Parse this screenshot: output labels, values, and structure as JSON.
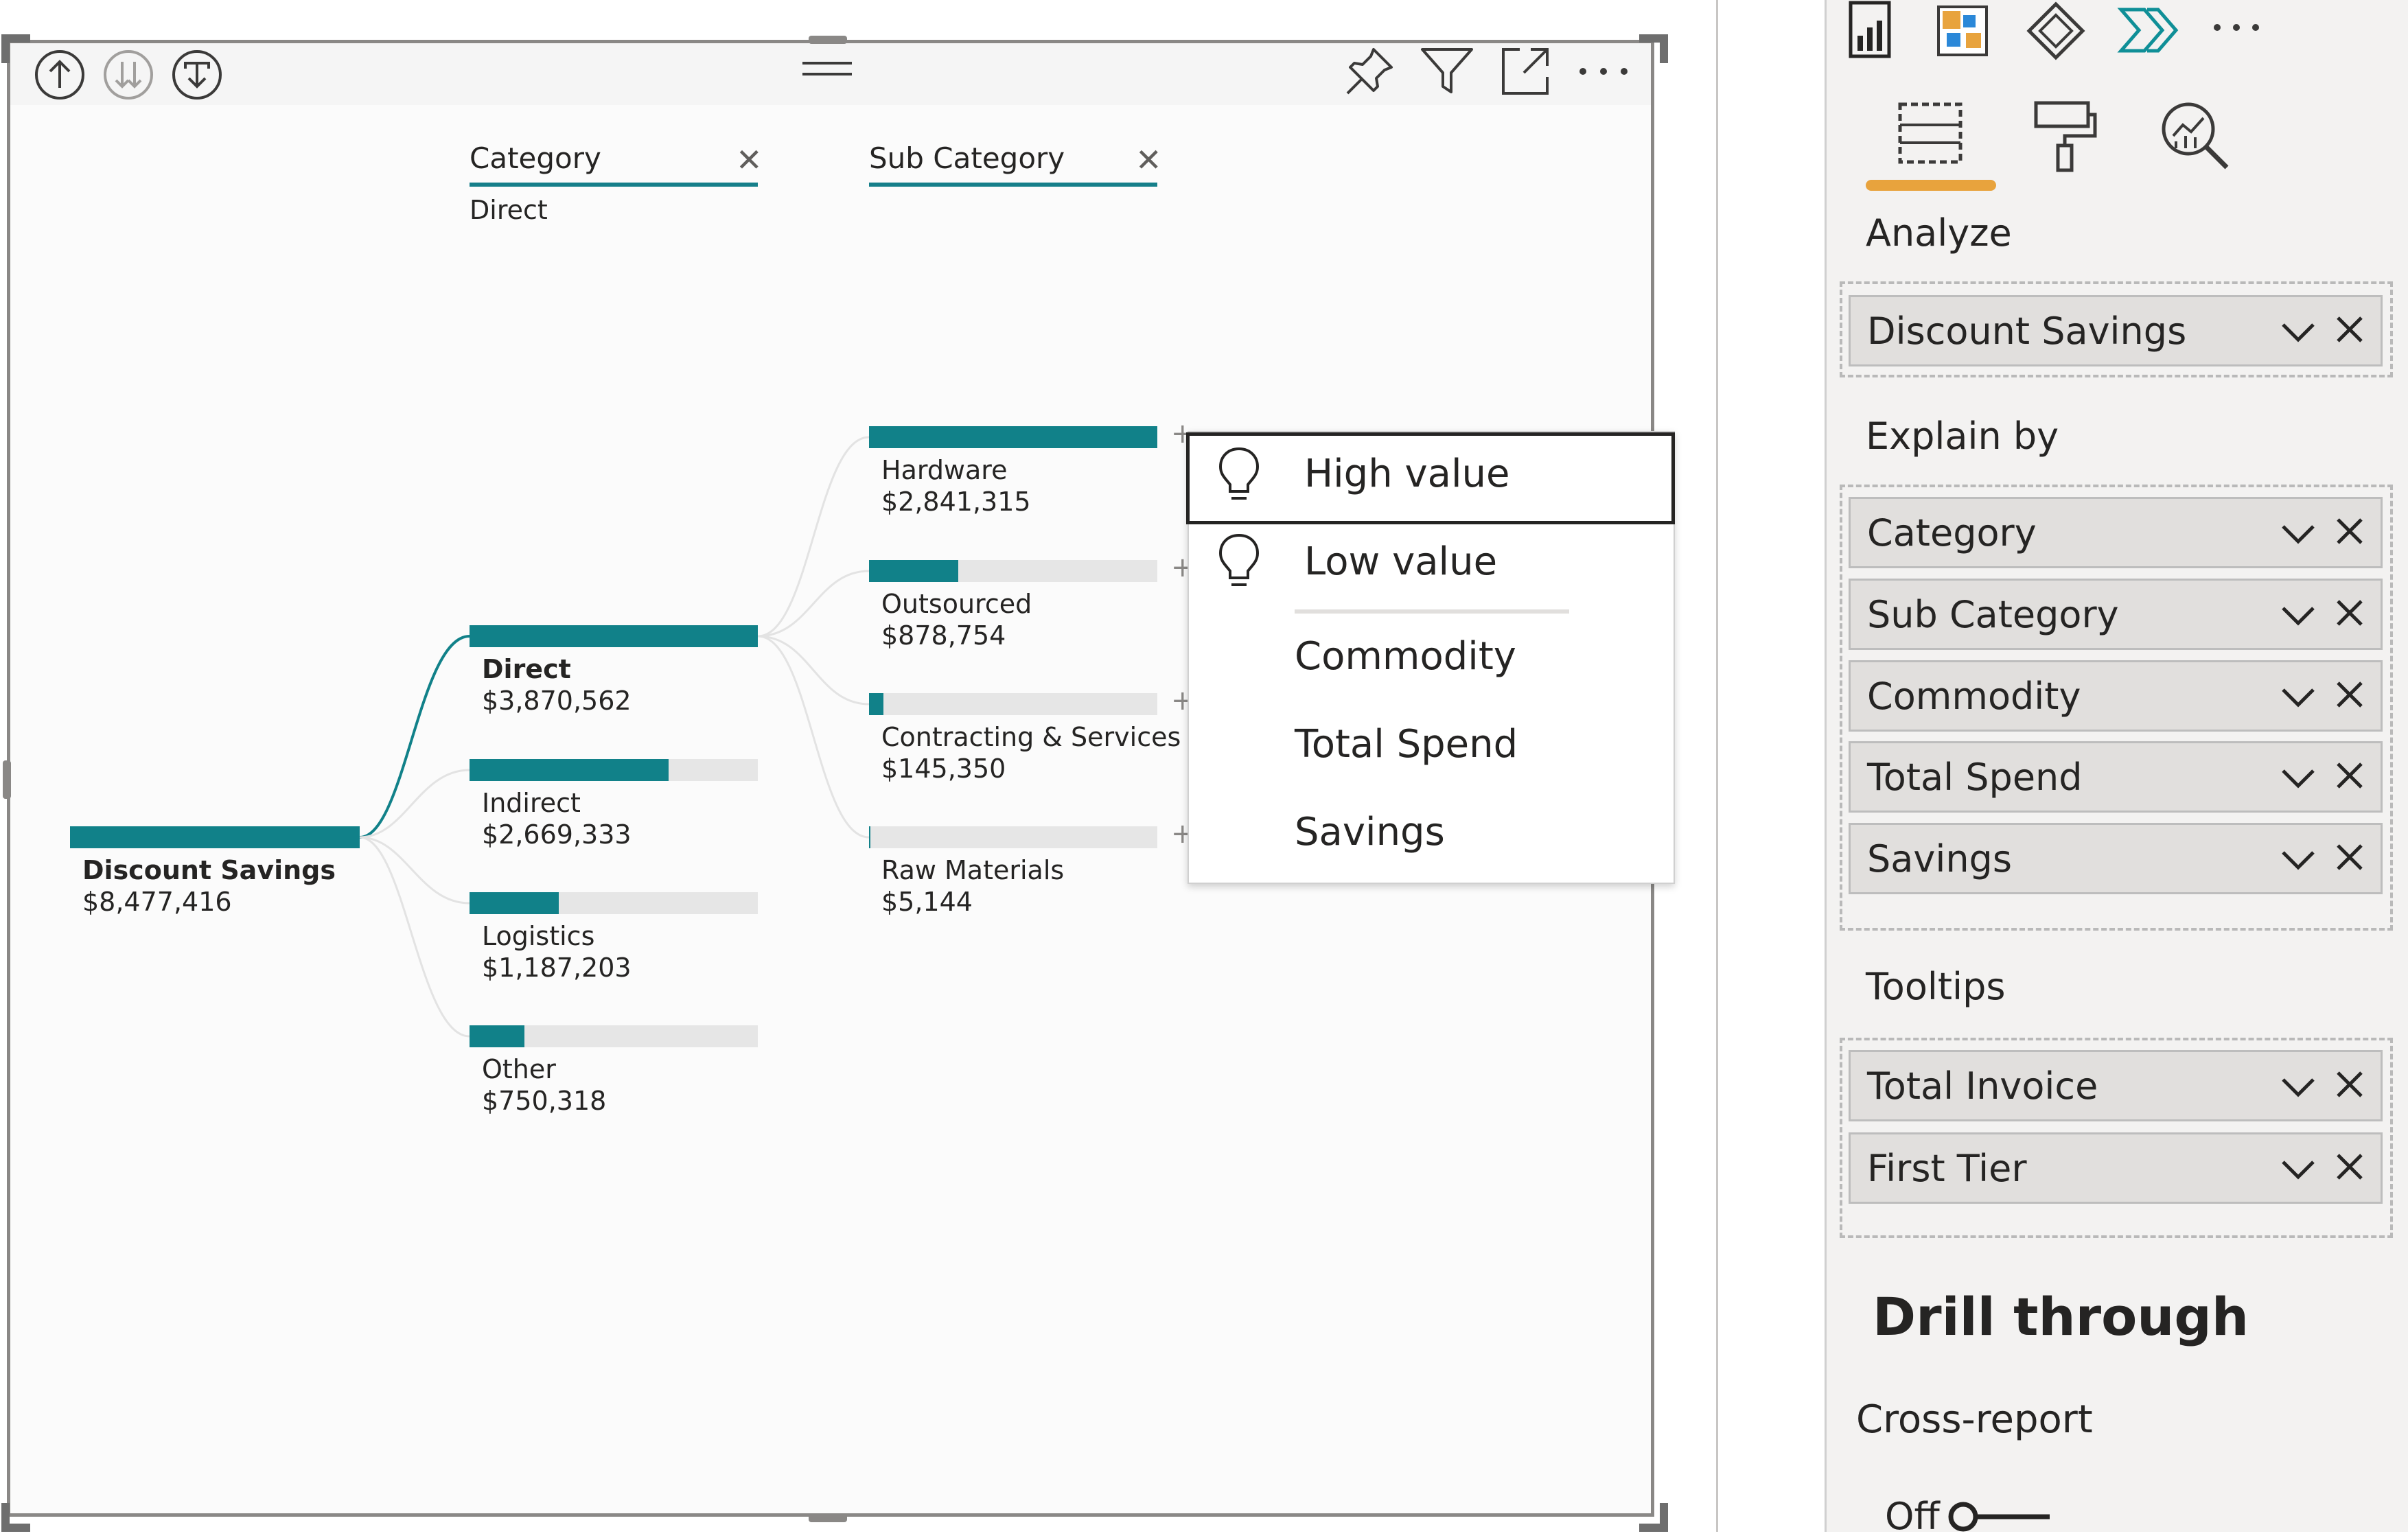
{
  "visual_toolbar": {
    "icons": [
      "drill-up-icon",
      "drill-down-all-icon",
      "expand-next-level-icon",
      "drag-handle-icon",
      "pin-icon",
      "filter-icon",
      "focus-mode-icon",
      "more-options-icon"
    ]
  },
  "columns": [
    {
      "header": "Category",
      "filter": "Direct"
    },
    {
      "header": "Sub Category",
      "filter": ""
    }
  ],
  "root": {
    "label": "Discount Savings",
    "value": "$8,477,416",
    "fill": 1.0
  },
  "category_nodes": [
    {
      "label": "Direct",
      "value": "$3,870,562",
      "fill": 1.0,
      "selected": true
    },
    {
      "label": "Indirect",
      "value": "$2,669,333",
      "fill": 0.69
    },
    {
      "label": "Logistics",
      "value": "$1,187,203",
      "fill": 0.31
    },
    {
      "label": "Other",
      "value": "$750,318",
      "fill": 0.19
    }
  ],
  "subcategory_nodes": [
    {
      "label": "Hardware",
      "value": "$2,841,315",
      "fill": 1.0
    },
    {
      "label": "Outsourced",
      "value": "$878,754",
      "fill": 0.31
    },
    {
      "label": "Contracting & Services",
      "value": "$145,350",
      "fill": 0.05
    },
    {
      "label": "Raw Materials",
      "value": "$5,144",
      "fill": 0.005
    }
  ],
  "plus_glyph": "+",
  "menu": {
    "ai_items": [
      "High value",
      "Low value"
    ],
    "fields": [
      "Commodity",
      "Total Spend",
      "Savings"
    ]
  },
  "pane": {
    "top_icons": [
      "report-icon",
      "power-apps-icon",
      "visual-icon",
      "power-automate-icon",
      "more-icon"
    ],
    "tabs": [
      "fields-tab-icon",
      "format-tab-icon",
      "analytics-tab-icon"
    ],
    "accent_color": "#e8a33d",
    "analyze": {
      "title": "Analyze",
      "fields": [
        "Discount Savings"
      ]
    },
    "explain_by": {
      "title": "Explain by",
      "fields": [
        "Category",
        "Sub Category",
        "Commodity",
        "Total Spend",
        "Savings"
      ]
    },
    "tooltips": {
      "title": "Tooltips",
      "fields": [
        "Total Invoice",
        "First Tier"
      ]
    },
    "drill_through": {
      "title": "Drill through",
      "cross_report": "Cross-report",
      "toggle_state": "Off"
    }
  },
  "colors": {
    "teal": "#118189",
    "track": "#e6e6e6"
  }
}
